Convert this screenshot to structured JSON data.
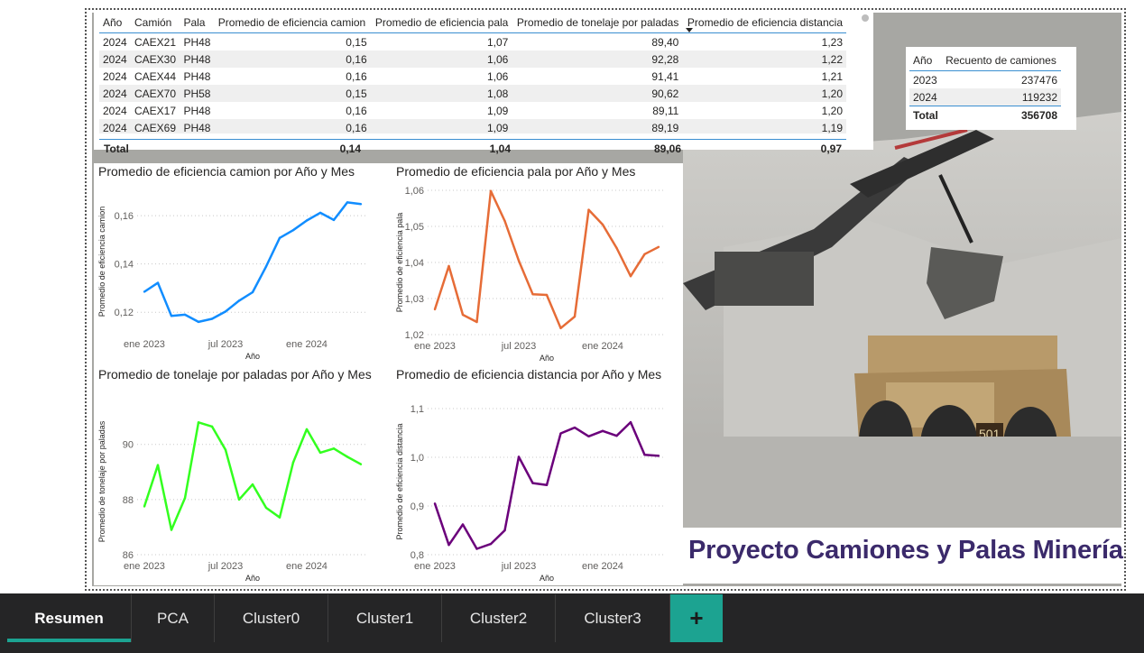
{
  "main_table": {
    "headers": [
      "Año",
      "Camión",
      "Pala",
      "Promedio de eficiencia camion",
      "Promedio de eficiencia pala",
      "Promedio de tonelaje por paladas",
      "Promedio de eficiencia distancia"
    ],
    "rows": [
      [
        "2024",
        "CAEX21",
        "PH48",
        "0,15",
        "1,07",
        "89,40",
        "1,23"
      ],
      [
        "2024",
        "CAEX30",
        "PH48",
        "0,16",
        "1,06",
        "92,28",
        "1,22"
      ],
      [
        "2024",
        "CAEX44",
        "PH48",
        "0,16",
        "1,06",
        "91,41",
        "1,21"
      ],
      [
        "2024",
        "CAEX70",
        "PH58",
        "0,15",
        "1,08",
        "90,62",
        "1,20"
      ],
      [
        "2024",
        "CAEX17",
        "PH48",
        "0,16",
        "1,09",
        "89,11",
        "1,20"
      ],
      [
        "2024",
        "CAEX69",
        "PH48",
        "0,16",
        "1,09",
        "89,19",
        "1,19"
      ]
    ],
    "total": {
      "label": "Total",
      "camion": "0,14",
      "pala": "1,04",
      "tonelaje": "89,06",
      "distancia": "0,97"
    }
  },
  "count_table": {
    "headers": [
      "Año",
      "Recuento de camiones"
    ],
    "rows": [
      [
        "2023",
        "237476"
      ],
      [
        "2024",
        "119232"
      ]
    ],
    "total": {
      "label": "Total",
      "value": "356708"
    }
  },
  "report_title": "Proyecto Camiones y Palas Minería",
  "chart_data": [
    {
      "type": "line",
      "title": "Promedio de eficiencia camion por Año y Mes",
      "xlabel": "Año",
      "ylabel": "Promedio de eficiencia camion",
      "x_ticks": [
        "ene 2023",
        "jul 2023",
        "ene 2024"
      ],
      "y_ticks": [
        "0,12",
        "0,14",
        "0,16"
      ],
      "y_tick_values": [
        0.12,
        0.14,
        0.16
      ],
      "ylim": [
        0.1115,
        0.1705
      ],
      "color": "#118dff",
      "series": [
        {
          "values": [
            0.1285,
            0.1322,
            0.1185,
            0.119,
            0.116,
            0.1173,
            0.1203,
            0.1248,
            0.1283,
            0.139,
            0.1508,
            0.154,
            0.158,
            0.1612,
            0.1582,
            0.1655,
            0.1648
          ]
        }
      ]
    },
    {
      "type": "line",
      "title": "Promedio de eficiencia pala por Año y Mes",
      "xlabel": "Año",
      "ylabel": "Promedio de eficiencia pala",
      "x_ticks": [
        "ene 2023",
        "jul 2023",
        "ene 2024"
      ],
      "y_ticks": [
        "1,02",
        "1,03",
        "1,04",
        "1,05",
        "1,06"
      ],
      "y_tick_values": [
        1.02,
        1.03,
        1.04,
        1.05,
        1.06
      ],
      "ylim": [
        1.02,
        1.06
      ],
      "color": "#e66c37",
      "series": [
        {
          "values": [
            1.027,
            1.039,
            1.0255,
            1.0235,
            1.0598,
            1.0515,
            1.0405,
            1.0312,
            1.031,
            1.0218,
            1.025,
            1.0546,
            1.0505,
            1.044,
            1.0362,
            1.0423,
            1.0443
          ]
        }
      ]
    },
    {
      "type": "line",
      "title": "Promedio de tonelaje por paladas por Año y Mes",
      "xlabel": "Año",
      "ylabel": "Promedio de tonelaje por paladas",
      "x_ticks": [
        "ene 2023",
        "jul 2023",
        "ene 2024"
      ],
      "y_ticks": [
        "86",
        "88",
        "90"
      ],
      "y_tick_values": [
        86,
        88,
        90
      ],
      "ylim": [
        86,
        91.3
      ],
      "color": "#33ff1f",
      "series": [
        {
          "values": [
            87.75,
            89.25,
            86.9,
            88.05,
            90.8,
            90.65,
            89.8,
            88.0,
            88.55,
            87.7,
            87.35,
            89.35,
            90.55,
            89.7,
            89.85,
            89.55,
            89.28
          ]
        }
      ]
    },
    {
      "type": "line",
      "title": "Promedio de eficiencia distancia por Año y Mes",
      "xlabel": "Año",
      "ylabel": "Promedio de eficiencia distancia",
      "x_ticks": [
        "ene 2023",
        "jul 2023",
        "ene 2024"
      ],
      "y_ticks": [
        "0,8",
        "0,9",
        "1,0",
        "1,1"
      ],
      "y_tick_values": [
        0.8,
        0.9,
        1.0,
        1.1
      ],
      "ylim": [
        0.8,
        1.1
      ],
      "color": "#6b007b",
      "series": [
        {
          "values": [
            0.905,
            0.82,
            0.862,
            0.812,
            0.822,
            0.85,
            1.001,
            0.947,
            0.943,
            1.049,
            1.061,
            1.043,
            1.054,
            1.044,
            1.072,
            1.005,
            1.003
          ]
        }
      ]
    }
  ],
  "tabs": [
    {
      "label": "Resumen",
      "active": true
    },
    {
      "label": "PCA",
      "active": false
    },
    {
      "label": "Cluster0",
      "active": false
    },
    {
      "label": "Cluster1",
      "active": false
    },
    {
      "label": "Cluster2",
      "active": false
    },
    {
      "label": "Cluster3",
      "active": false
    }
  ],
  "add_tab_icon": "plus-icon",
  "accent_color": "#1ca391"
}
